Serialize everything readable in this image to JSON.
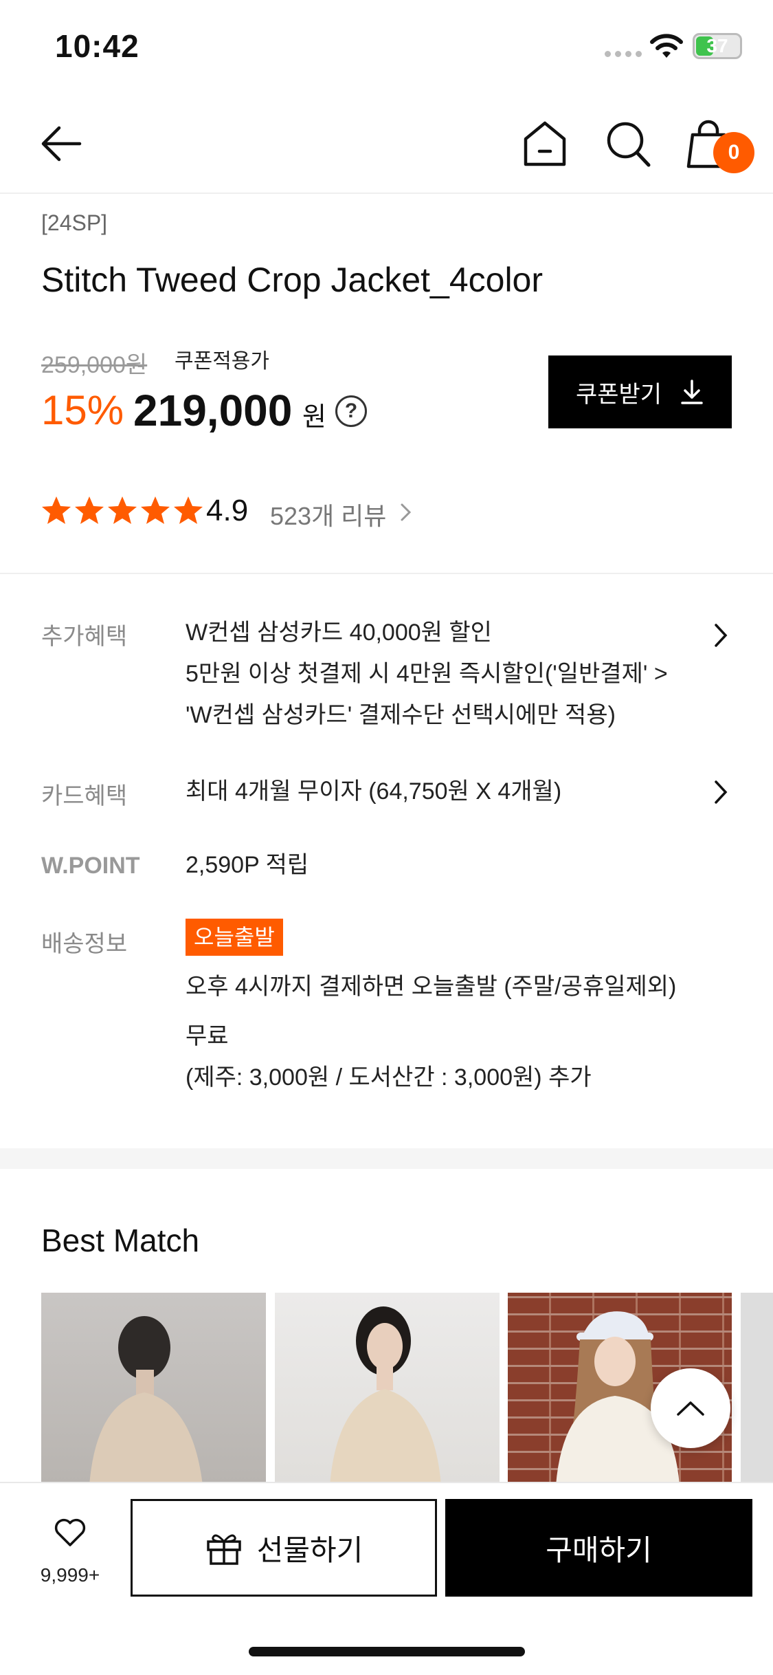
{
  "status_bar": {
    "time": "10:42",
    "battery": "37"
  },
  "nav": {
    "cart_count": "0"
  },
  "product": {
    "season": "[24SP]",
    "title": "Stitch Tweed Crop Jacket_4color",
    "original_price": "259,000원",
    "coupon_label": "쿠폰적용가",
    "discount": "15%",
    "price": "219,000",
    "currency": "원",
    "help": "?",
    "coupon_button": "쿠폰받기",
    "rating_value": 5,
    "rating": "4.9",
    "review_count": "523개 리뷰"
  },
  "benefits": {
    "extra_label": "추가혜택",
    "extra_lines": [
      "W컨셉 삼성카드 40,000원 할인",
      "5만원 이상 첫결제 시 4만원 즉시할인('일반결제' >",
      "'W컨셉 삼성카드' 결제수단 선택시에만 적용)"
    ],
    "card_label": "카드혜택",
    "card_text": "최대 4개월 무이자 (64,750원 X 4개월)",
    "point_label": "W.POINT",
    "point_text": "2,590P 적립",
    "shipping_label": "배송정보",
    "shipping_badge": "오늘출발",
    "shipping_lines": [
      "오후 4시까지 결제하면 오늘출발 (주말/공휴일제외)",
      "무료",
      "(제주: 3,000원 / 도서산간 : 3,000원) 추가"
    ]
  },
  "best_match": {
    "title": "Best Match"
  },
  "bottom_bar": {
    "like_count": "9,999+",
    "gift_button": "선물하기",
    "buy_button": "구매하기"
  },
  "colors": {
    "accent": "#ff5b00",
    "primary": "#000000"
  }
}
